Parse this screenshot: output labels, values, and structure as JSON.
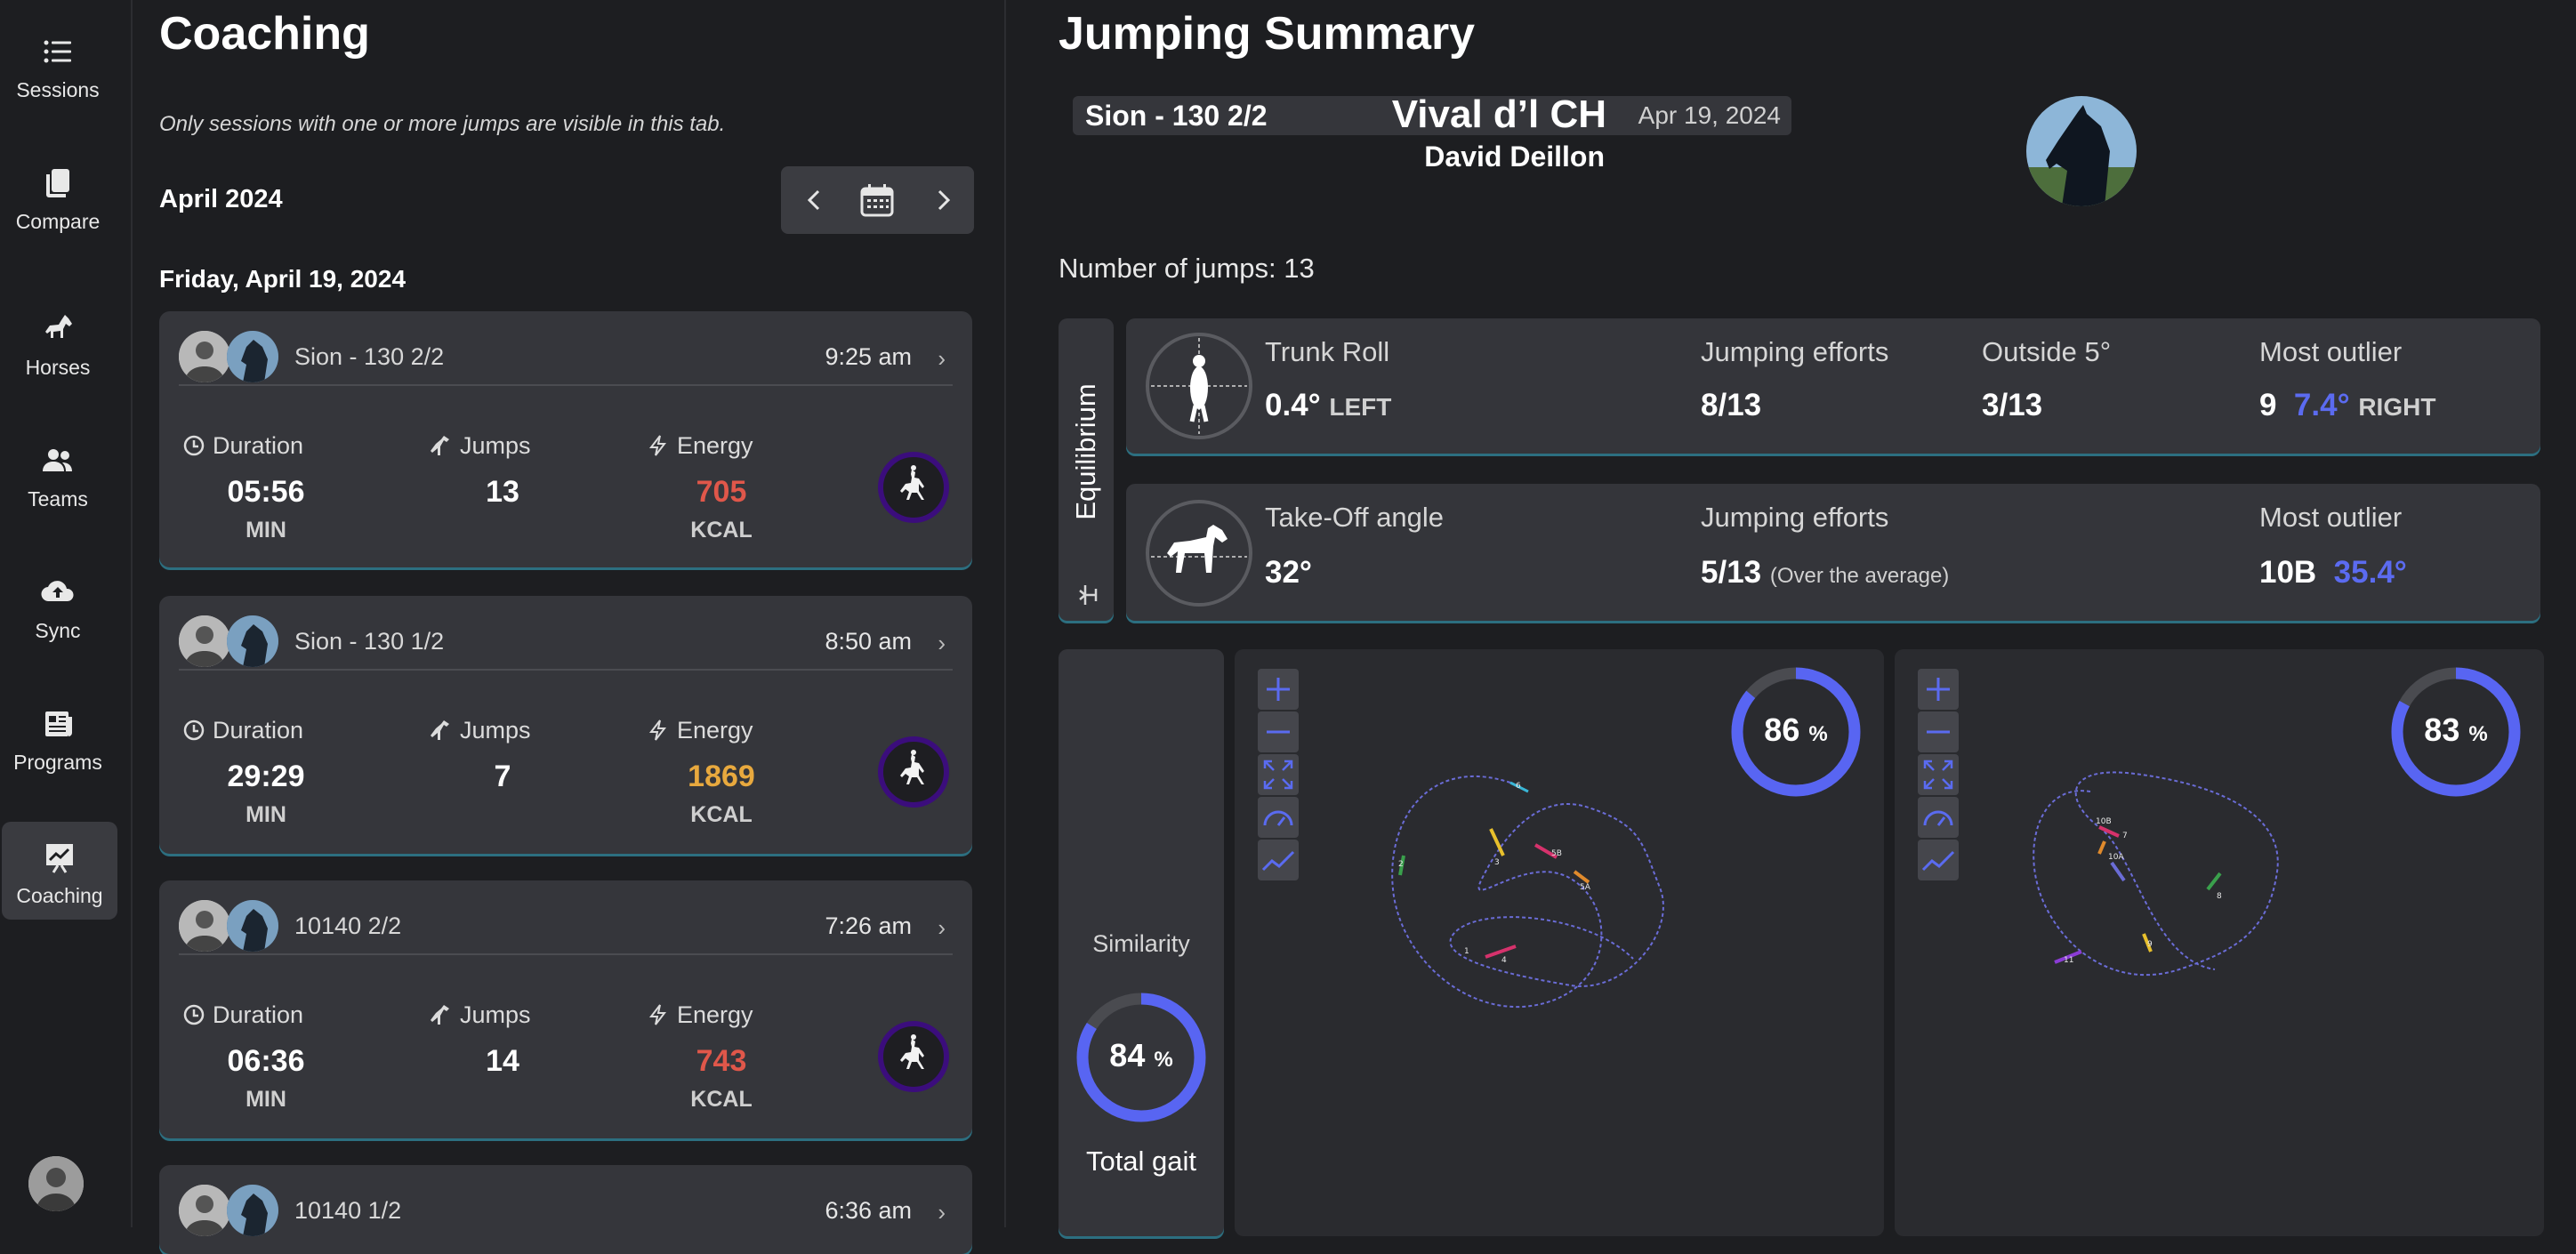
{
  "nav": {
    "items": [
      {
        "label": "Sessions",
        "icon": "list-icon"
      },
      {
        "label": "Compare",
        "icon": "copy-icon"
      },
      {
        "label": "Horses",
        "icon": "horse-icon"
      },
      {
        "label": "Teams",
        "icon": "users-icon"
      },
      {
        "label": "Sync",
        "icon": "cloud-upload-icon"
      },
      {
        "label": "Programs",
        "icon": "newspaper-icon"
      },
      {
        "label": "Coaching",
        "icon": "chart-board-icon",
        "active": true
      }
    ]
  },
  "coaching": {
    "title": "Coaching",
    "note": "Only sessions with one or more jumps are visible in this tab.",
    "month": "April 2024",
    "day_header": "Friday, April 19, 2024",
    "stat_labels": {
      "duration": "Duration",
      "jumps": "Jumps",
      "energy": "Energy"
    },
    "units": {
      "duration": "MIN",
      "energy": "KCAL"
    },
    "sessions": [
      {
        "name": "Sion - 130 2/2",
        "time": "9:25 am",
        "duration": "05:56",
        "jumps": "13",
        "energy": "705",
        "energy_color": "#e0574a"
      },
      {
        "name": "Sion - 130 1/2",
        "time": "8:50 am",
        "duration": "29:29",
        "jumps": "7",
        "energy": "1869",
        "energy_color": "#e8a93e"
      },
      {
        "name": "10140 2/2",
        "time": "7:26 am",
        "duration": "06:36",
        "jumps": "14",
        "energy": "743",
        "energy_color": "#e0574a"
      },
      {
        "name": "10140 1/2",
        "time": "6:36 am"
      }
    ]
  },
  "summary": {
    "title": "Jumping Summary",
    "session_name": "Sion - 130 2/2",
    "session_date": "Apr 19, 2024",
    "horse_name": "Vival d’l CH",
    "rider_name": "David Deillon",
    "jumps_count": "Number of jumps: 13",
    "equilibrium_label": "Equilibrium",
    "trunk": {
      "label": "Trunk Roll",
      "value": "0.4°",
      "side": "LEFT",
      "efforts_label": "Jumping efforts",
      "efforts": "8/13",
      "outside_label": "Outside 5°",
      "outside": "3/13",
      "outlier_label": "Most outlier",
      "outlier_jump": "9",
      "outlier_value": "7.4°",
      "outlier_side": "RIGHT"
    },
    "takeoff": {
      "label": "Take-Off angle",
      "value": "32°",
      "efforts_label": "Jumping efforts",
      "efforts": "5/13",
      "efforts_note": "(Over the average)",
      "outlier_label": "Most outlier",
      "outlier_jump": "10B",
      "outlier_value": "35.4°"
    },
    "similarity": {
      "label": "Similarity",
      "value": 84,
      "unit": "%",
      "caption": "Total gait"
    },
    "maps": [
      {
        "similarity": 86,
        "unit": "%"
      },
      {
        "similarity": 83,
        "unit": "%"
      }
    ],
    "colors": {
      "accent": "#5865f2",
      "ring_track": "#4a4b50"
    }
  }
}
